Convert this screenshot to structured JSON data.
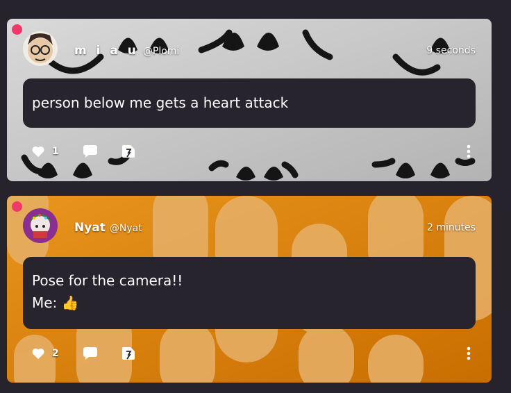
{
  "colors": {
    "page_background": "#26232d",
    "bubble_background": "#27242d",
    "online_dot": "#f0386b",
    "post1_background": "#c9c9c9",
    "post2_background": "#d17a0c"
  },
  "icons": {
    "like": "heart-icon",
    "comment": "speech-bubble-icon",
    "share": "share-icon",
    "more": "kebab-menu-icon"
  },
  "posts": [
    {
      "display_name": "m i a u",
      "handle": "@Plomi",
      "time": "9 seconds",
      "lines": [
        "person below me gets a heart attack"
      ],
      "likes": "1"
    },
    {
      "display_name": "Nyat",
      "handle": "@Nyat",
      "time": "2 minutes",
      "lines": [
        "Pose for the camera!!",
        "Me: 👍"
      ],
      "likes": "2"
    }
  ]
}
